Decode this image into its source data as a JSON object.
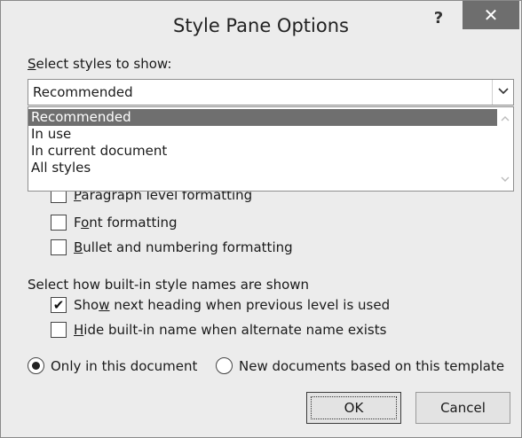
{
  "dialog": {
    "title": "Style Pane Options",
    "help_label": "?",
    "close_label": "✕"
  },
  "select_styles": {
    "label_accel": "S",
    "label_rest": "elect styles to show:",
    "value": "Recommended",
    "arrow": "⌄",
    "options": [
      "Recommended",
      "In use",
      "In current document",
      "All styles"
    ],
    "selected_index": 0
  },
  "formatting": {
    "paragraph": {
      "accel": "P",
      "rest": "aragraph level formatting",
      "checked": false
    },
    "font": {
      "pre": "F",
      "accel": "o",
      "rest": "nt formatting",
      "checked": false
    },
    "bullet": {
      "accel": "B",
      "rest": "ullet and numbering formatting",
      "checked": false
    }
  },
  "builtin": {
    "heading": "Select how built-in style names are shown",
    "show_next": {
      "pre": "Sho",
      "accel": "w",
      "rest": " next heading when previous level is used",
      "checked": true
    },
    "hide_builtin": {
      "accel": "H",
      "rest": "ide built-in name when alternate name exists",
      "checked": false
    }
  },
  "scope": {
    "only_document": {
      "label": "Only in this document",
      "selected": true
    },
    "new_documents": {
      "label": "New documents based on this template",
      "selected": false
    }
  },
  "buttons": {
    "ok": "OK",
    "cancel": "Cancel"
  },
  "glyphs": {
    "check": "✔",
    "scroll_up": "⌃",
    "scroll_down": "⌄"
  }
}
